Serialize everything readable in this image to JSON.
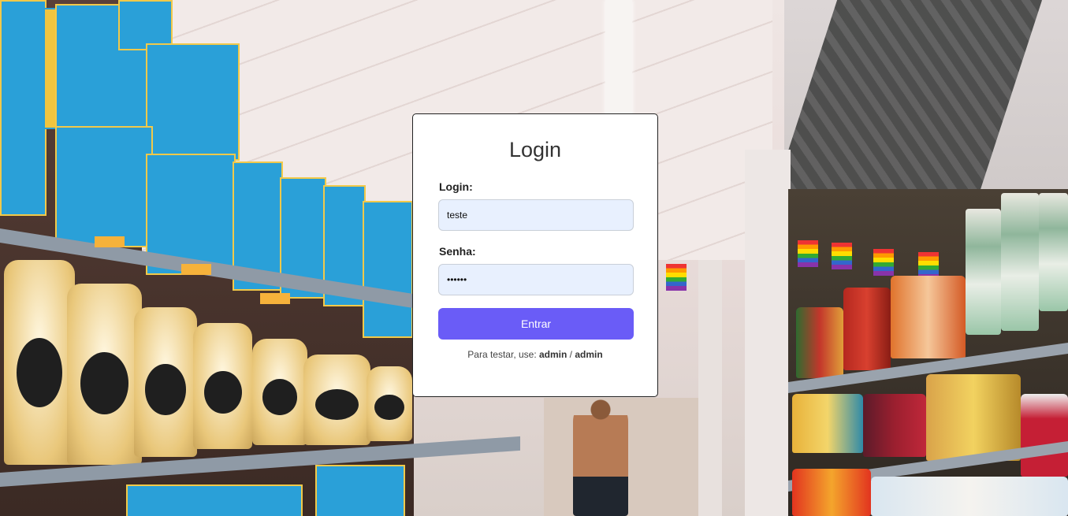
{
  "login": {
    "title": "Login",
    "username_label": "Login:",
    "username_value": "teste",
    "password_label": "Senha:",
    "password_value": "••••••",
    "submit_label": "Entrar",
    "hint_prefix": "Para testar, use: ",
    "hint_user": "admin",
    "hint_separator": " / ",
    "hint_pass": "admin"
  },
  "colors": {
    "button": "#6a5cf7",
    "field_bg": "#e8f0fe"
  },
  "background": {
    "scene": "supermarket-aisle-photo"
  }
}
